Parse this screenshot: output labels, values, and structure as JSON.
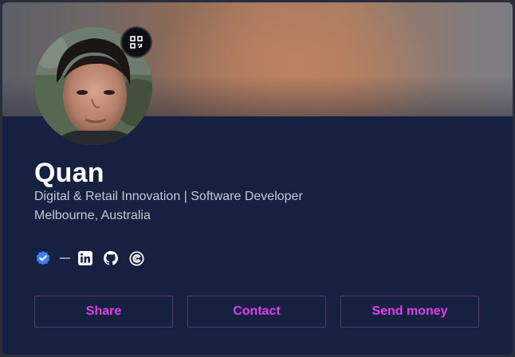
{
  "profile": {
    "name": "Quan",
    "headline": "Digital & Retail Innovation | Software Developer",
    "location": "Melbourne, Australia"
  },
  "icons": {
    "qr": "qr-code-icon",
    "verified": "verified-badge-icon",
    "linkedin": "linkedin-icon",
    "github": "github-icon",
    "other": "circle-c-icon"
  },
  "actions": {
    "share": "Share",
    "contact": "Contact",
    "send_money": "Send money"
  },
  "colors": {
    "card_background": "#162040",
    "accent": "#e040e8",
    "button_border": "#4b3c74",
    "verified": "#3b82f6"
  }
}
